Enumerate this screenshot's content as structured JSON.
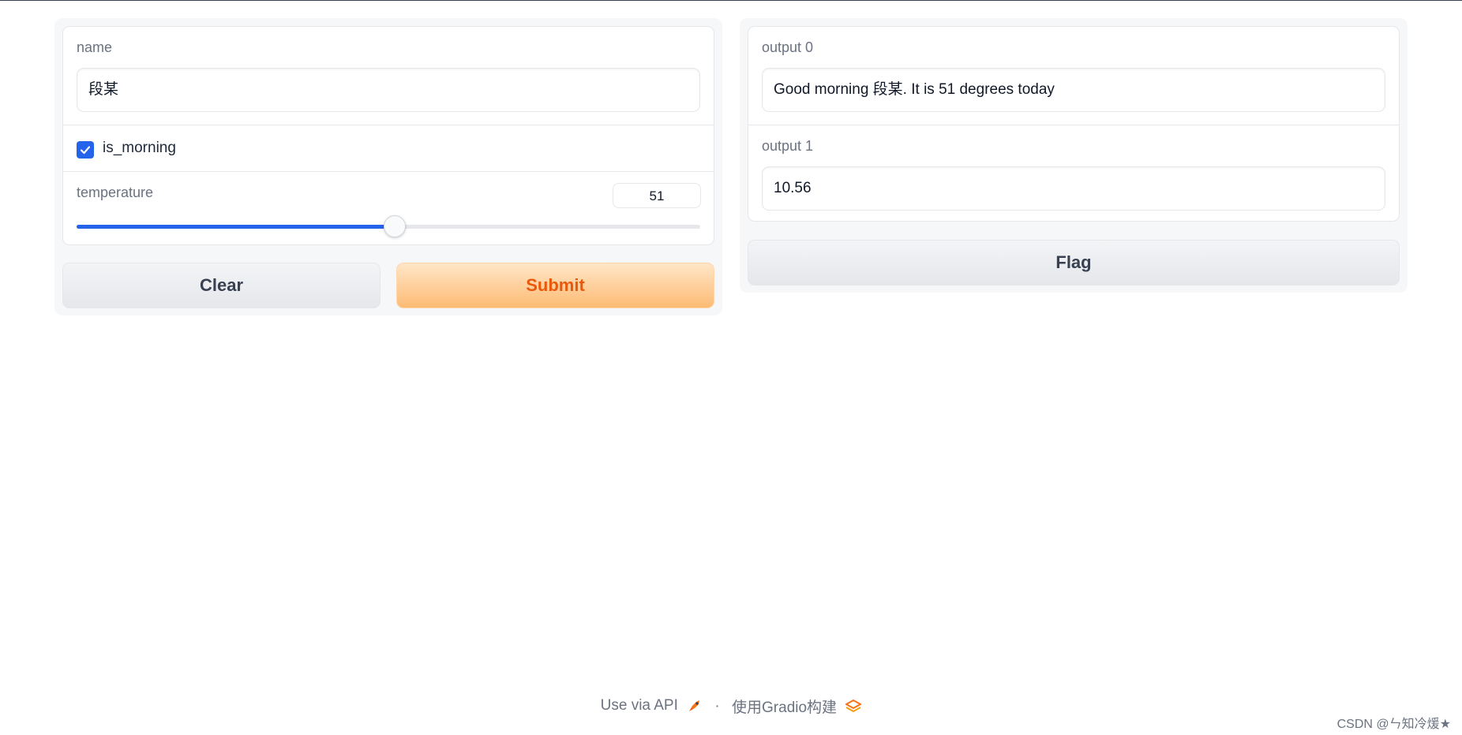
{
  "inputs": {
    "name": {
      "label": "name",
      "value": "段某"
    },
    "is_morning": {
      "label": "is_morning",
      "checked": true
    },
    "temperature": {
      "label": "temperature",
      "value": "51",
      "fraction": 0.51
    }
  },
  "buttons": {
    "clear": "Clear",
    "submit": "Submit",
    "flag": "Flag"
  },
  "outputs": {
    "output0": {
      "label": "output 0",
      "value": "Good morning 段某. It is 51 degrees today"
    },
    "output1": {
      "label": "output 1",
      "value": "10.56"
    }
  },
  "footer": {
    "api_link": "Use via API",
    "separator": "·",
    "built_with": "使用Gradio构建"
  },
  "watermark": "CSDN @ㄣ知冷煖★",
  "colors": {
    "accent": "#2563eb",
    "primary_text": "#ea580c"
  },
  "icons": {
    "api": "rocket-icon",
    "gradio": "gradio-logo-icon",
    "check": "check-icon"
  }
}
